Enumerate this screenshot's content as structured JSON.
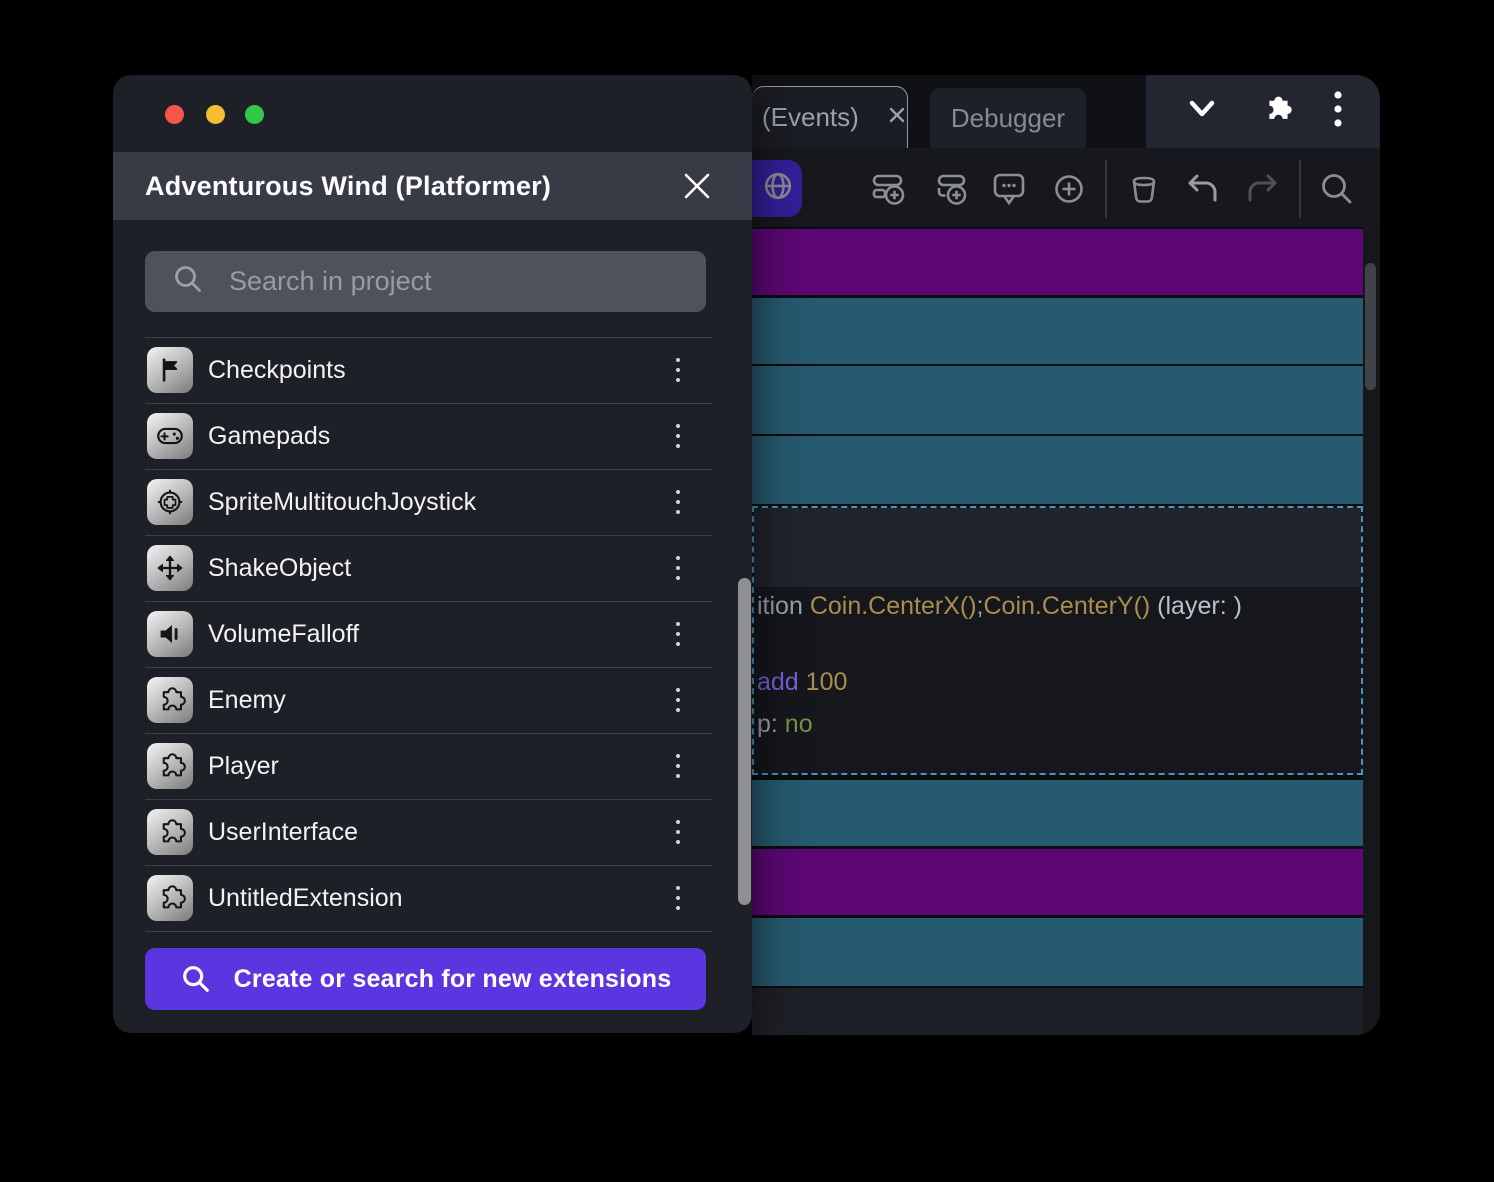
{
  "dialog": {
    "title": "Adventurous Wind (Platformer)",
    "close_icon": "close-icon",
    "search_placeholder": "Search in project",
    "items": [
      {
        "label": "Checkpoints",
        "icon": "flag-icon"
      },
      {
        "label": "Gamepads",
        "icon": "gamepad-icon"
      },
      {
        "label": "SpriteMultitouchJoystick",
        "icon": "joystick-icon"
      },
      {
        "label": "ShakeObject",
        "icon": "move-arrows-icon"
      },
      {
        "label": "VolumeFalloff",
        "icon": "speaker-icon"
      },
      {
        "label": "Enemy",
        "icon": "puzzle-icon"
      },
      {
        "label": "Player",
        "icon": "puzzle-icon"
      },
      {
        "label": "UserInterface",
        "icon": "puzzle-icon"
      },
      {
        "label": "UntitledExtension",
        "icon": "puzzle-icon"
      }
    ],
    "cta_label": "Create or search for new extensions",
    "traffic_lights": [
      "close",
      "minimize",
      "zoom"
    ]
  },
  "editor": {
    "tabs": [
      {
        "label": "(Events)",
        "active": true,
        "closable": true
      },
      {
        "label": "Debugger",
        "active": false
      }
    ],
    "header_icons": [
      "chevron-down-icon",
      "puzzle-icon",
      "kebab-menu-icon"
    ],
    "toolbar_icons": [
      "globe-icon",
      "add-event-icon",
      "add-subevent-icon",
      "add-comment-icon",
      "add-circle-icon",
      "trash-icon",
      "undo-icon",
      "redo-icon",
      "search-icon"
    ],
    "rows": [
      "purple",
      "teal",
      "teal",
      "teal",
      "selected",
      "teal",
      "purple",
      "teal"
    ],
    "selected_event": {
      "line1": [
        {
          "t": "ition ",
          "c": "gray"
        },
        {
          "t": "Coin.CenterX()",
          "c": "gold"
        },
        {
          "t": ";",
          "c": "gray"
        },
        {
          "t": "Coin.CenterY()",
          "c": "gold"
        },
        {
          "t": " (layer: )",
          "c": "light"
        }
      ],
      "line2": [
        {
          "t": "add ",
          "c": "purple"
        },
        {
          "t": "100",
          "c": "gold"
        }
      ],
      "line3": [
        {
          "t": "p: ",
          "c": "gray"
        },
        {
          "t": "no",
          "c": "green"
        }
      ]
    }
  },
  "colors": {
    "accent": "#5b35e0",
    "toolbar_toggle": "#31209a",
    "event_purple": "#5c0775",
    "event_teal": "#265a6f",
    "selection_border": "#4d93bd",
    "code_gold": "#aa8d4e",
    "code_gray": "#9ba1ad",
    "code_light": "#bac0cb",
    "code_purple": "#7d5fd2",
    "code_green": "#70963f",
    "traffic_red": "#f5564c",
    "traffic_yellow": "#f5bd2f",
    "traffic_green": "#33c748"
  }
}
